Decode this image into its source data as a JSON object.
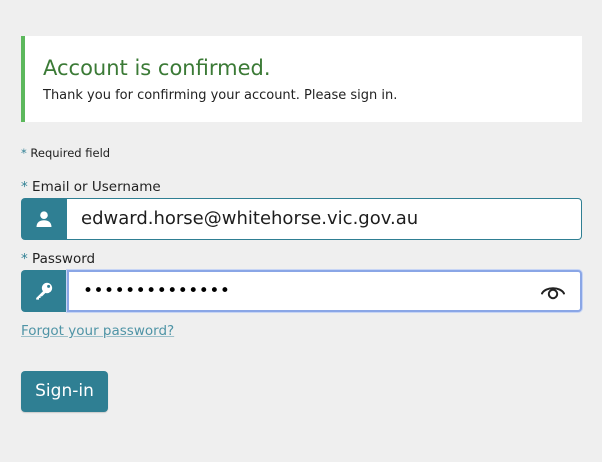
{
  "alert": {
    "title": "Account is confirmed.",
    "message": "Thank you for confirming your account. Please sign in."
  },
  "form": {
    "required_marker": "*",
    "required_note": "Required field",
    "username": {
      "label": "Email or Username",
      "value": "edward.horse@whitehorse.vic.gov.au",
      "icon": "user-icon"
    },
    "password": {
      "label": "Password",
      "value": "••••••••••••••",
      "icon": "key-icon",
      "toggle_icon": "eye-icon"
    },
    "forgot_link": "Forgot your password?",
    "submit_label": "Sign-in"
  },
  "colors": {
    "accent": "#2f7f93",
    "success_border": "#5cb85c",
    "success_text": "#3b7a36",
    "link": "#4f94a6",
    "background": "#efefef"
  }
}
